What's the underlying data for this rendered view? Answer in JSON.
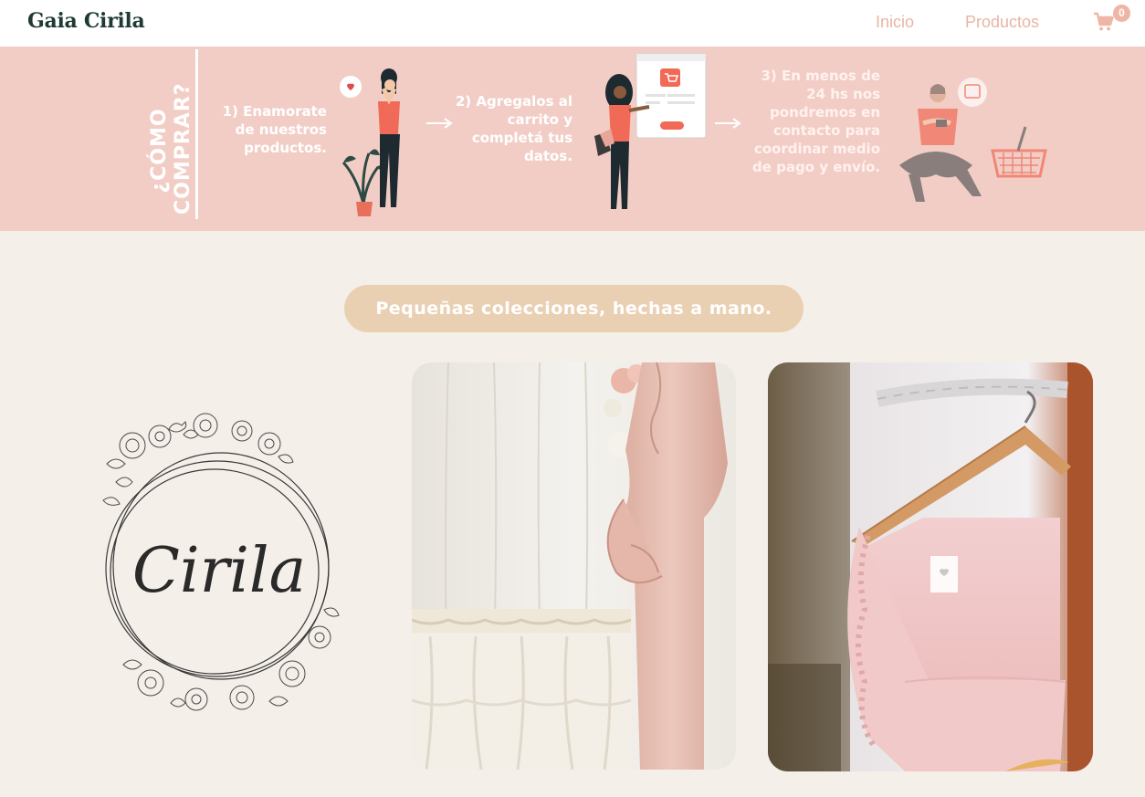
{
  "nav": {
    "brand": "Gaia Cirila",
    "links": [
      {
        "label": "Inicio"
      },
      {
        "label": "Productos"
      }
    ],
    "cart_count": "0",
    "cart_icon": "shopping-cart-icon"
  },
  "how_to_buy": {
    "title_line1": "¿CÓMO",
    "title_line2": "COMPRAR?",
    "steps": [
      {
        "text": "1) Enamorate de nuestros productos."
      },
      {
        "text": "2) Agregalos al carrito y completá tus datos."
      },
      {
        "text": "3) En menos de 24 hs nos pondremos en contacto para coordinar medio de pago y envío."
      }
    ]
  },
  "collection": {
    "heading": "Pequeñas colecciones, hechas a mano.",
    "logo_text": "Cirila"
  },
  "colors": {
    "brand_dark": "#1f3a34",
    "accent_pink": "#f2cdc6",
    "nav_link": "#e9b5a4",
    "pill_bg": "#ead0b3",
    "page_bg": "#f5efe9"
  }
}
